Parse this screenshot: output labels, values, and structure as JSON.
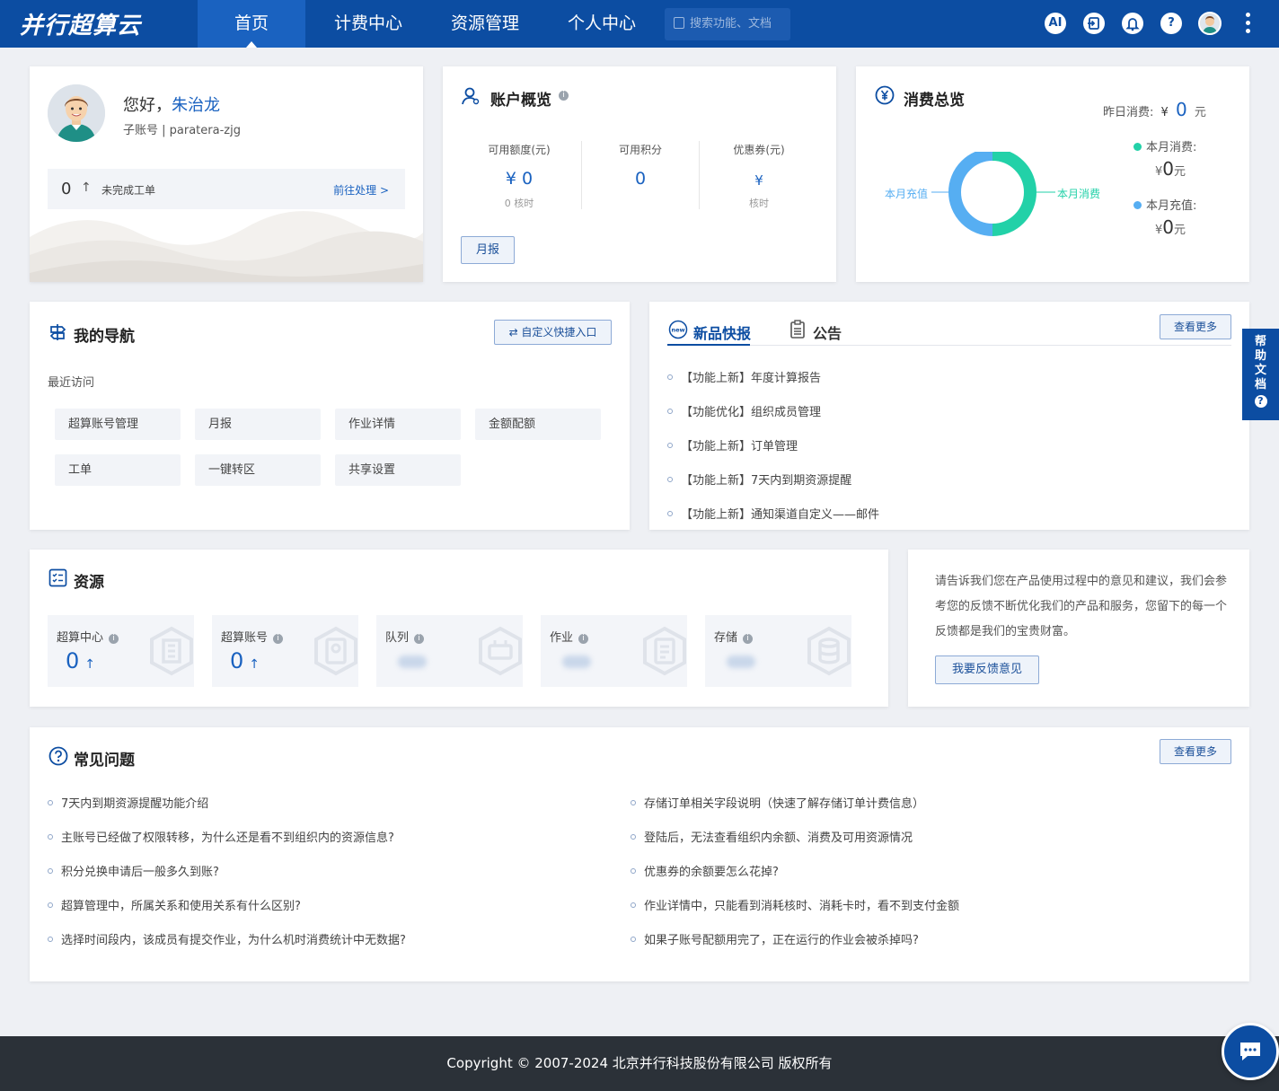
{
  "header": {
    "logo": "并行超算云",
    "nav": [
      "首页",
      "计费中心",
      "资源管理",
      "个人中心"
    ],
    "search_placeholder": "搜索功能、文档",
    "ai_label": "AI",
    "help_label": "?"
  },
  "profile": {
    "greeting": "您好，",
    "name": "朱治龙",
    "sub_account": "子账号 | paratera-zjg",
    "ticket_count": "0",
    "ticket_arrow": "↑",
    "ticket_label": "未完成工单",
    "ticket_link": "前往处理 >"
  },
  "account": {
    "title": "账户概览",
    "stats": [
      {
        "label": "可用额度(元)",
        "value": "¥ 0",
        "sub": "0 核时"
      },
      {
        "label": "可用积分",
        "value": "0",
        "sub": ""
      },
      {
        "label": "优惠券(元)",
        "value": "¥",
        "sub": "核时"
      }
    ],
    "report_button": "月报"
  },
  "consumption": {
    "title": "消费总览",
    "yesterday_label": "昨日消费:",
    "yesterday_currency": "¥",
    "yesterday_value": "0",
    "yesterday_unit": "元",
    "donut_left_label": "本月充值",
    "donut_right_label": "本月消费",
    "legend": [
      {
        "label": "本月消费:",
        "currency": "¥",
        "value": "0",
        "unit": "元",
        "color": "#22d1a8"
      },
      {
        "label": "本月充值:",
        "currency": "¥",
        "value": "0",
        "unit": "元",
        "color": "#56aef2"
      }
    ]
  },
  "my_nav": {
    "title": "我的导航",
    "custom_button": "⇄ 自定义快捷入口",
    "recent_label": "最近访问",
    "items": [
      "超算账号管理",
      "月报",
      "作业详情",
      "金额配额",
      "工单",
      "一键转区",
      "共享设置"
    ]
  },
  "news": {
    "tab_new": "新品快报",
    "tab_notice": "公告",
    "more_button": "查看更多",
    "items": [
      "【功能上新】年度计算报告",
      "【功能优化】组织成员管理",
      "【功能上新】订单管理",
      "【功能上新】7天内到期资源提醒",
      "【功能上新】通知渠道自定义——邮件"
    ]
  },
  "resources": {
    "title": "资源",
    "items": [
      {
        "label": "超算中心",
        "value": "0",
        "arrow": "↑"
      },
      {
        "label": "超算账号",
        "value": "0",
        "arrow": "↑"
      },
      {
        "label": "队列",
        "value": "",
        "arrow": ""
      },
      {
        "label": "作业",
        "value": "",
        "arrow": ""
      },
      {
        "label": "存储",
        "value": "",
        "arrow": ""
      }
    ]
  },
  "feedback": {
    "text": "请告诉我们您在产品使用过程中的意见和建议，我们会参考您的反馈不断优化我们的产品和服务，您留下的每一个反馈都是我们的宝贵财富。",
    "button": "我要反馈意见"
  },
  "faq": {
    "title": "常见问题",
    "more_button": "查看更多",
    "left": [
      "7天内到期资源提醒功能介绍",
      "主账号已经做了权限转移，为什么还是看不到组织内的资源信息?",
      "积分兑换申请后一般多久到账?",
      "超算管理中，所属关系和使用关系有什么区别?",
      "选择时间段内，该成员有提交作业，为什么机时消费统计中无数据?"
    ],
    "right": [
      "存储订单相关字段说明（快速了解存储订单计费信息）",
      "登陆后，无法查看组织内余额、消费及可用资源情况",
      "优惠券的余额要怎么花掉?",
      "作业详情中，只能看到消耗核时、消耗卡时，看不到支付金额",
      "如果子账号配额用完了，正在运行的作业会被杀掉吗?"
    ]
  },
  "help_tab": {
    "label": "帮助文档",
    "q": "?"
  },
  "footer": {
    "copyright": "Copyright © 2007-2024 北京并行科技股份有限公司 版权所有"
  }
}
